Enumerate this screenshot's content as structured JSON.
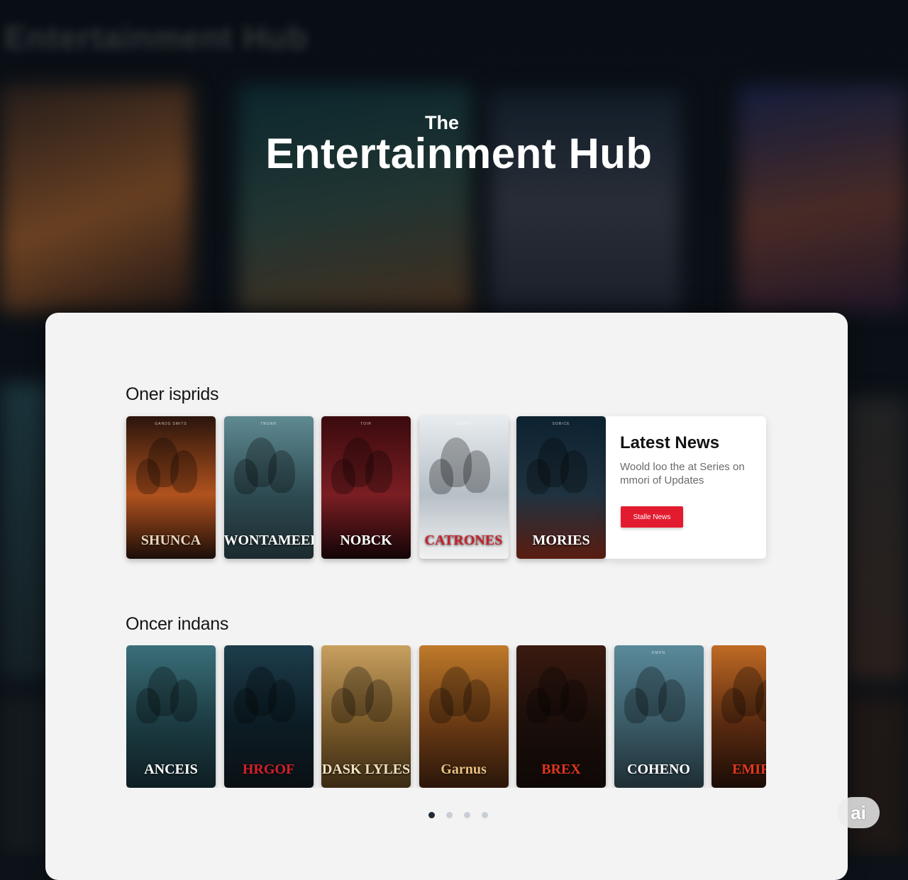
{
  "hero": {
    "kicker": "The",
    "title": "Entertainment Hub"
  },
  "sections": [
    {
      "title": "Oner isprids",
      "posters": [
        {
          "title": "SHUNCA",
          "credit": "GANDS SMITS",
          "colors": [
            "#2a140c",
            "#b0521e",
            "#1b0d08"
          ],
          "title_color": "#e9d6bf"
        },
        {
          "title": "WONTAMEER",
          "credit": "TRUNN",
          "colors": [
            "#5f8a92",
            "#2e4b52",
            "#1b2a2e"
          ],
          "title_color": "#ffffff"
        },
        {
          "title": "NOBCK",
          "credit": "TOIR",
          "colors": [
            "#3a0a0e",
            "#7a1e22",
            "#120406"
          ],
          "title_color": "#ffffff"
        },
        {
          "title": "CATRONES",
          "credit": "MIERR",
          "colors": [
            "#e8ecef",
            "#b6bfc6",
            "#f2f2f2"
          ],
          "title_color": "#c8202a"
        },
        {
          "title": "MORIES",
          "credit": "SOBICE",
          "colors": [
            "#0d2230",
            "#1f3240",
            "#5a1c10"
          ],
          "title_color": "#ffffff"
        }
      ]
    },
    {
      "title": "Oncer indans",
      "posters": [
        {
          "title": "ANCEIS",
          "credit": "",
          "colors": [
            "#3a6f7a",
            "#1c3b42",
            "#0e1f24"
          ],
          "title_color": "#ffffff"
        },
        {
          "title": "HRGOF",
          "credit": "",
          "colors": [
            "#1d3d4c",
            "#0c1c24",
            "#0a1014"
          ],
          "title_color": "#d61f2a"
        },
        {
          "title": "DASK LYLES",
          "credit": "",
          "colors": [
            "#c8a060",
            "#7a5a2a",
            "#3a2a14"
          ],
          "title_color": "#f0e2c0"
        },
        {
          "title": "Garnus",
          "credit": "",
          "colors": [
            "#c07a2a",
            "#6a3a14",
            "#2a160a"
          ],
          "title_color": "#e8c080"
        },
        {
          "title": "BREX",
          "credit": "",
          "colors": [
            "#3a1a10",
            "#1a0e0a",
            "#0e0806"
          ],
          "title_color": "#e0361e"
        },
        {
          "title": "COHENO",
          "credit": "KMON",
          "colors": [
            "#5a8a9a",
            "#3a5a66",
            "#1e2e34"
          ],
          "title_color": "#ffffff"
        },
        {
          "title": "EMIRE",
          "credit": "",
          "colors": [
            "#c06a24",
            "#5a2a10",
            "#1a0c06"
          ],
          "title_color": "#e03a1e"
        }
      ]
    }
  ],
  "news": {
    "heading": "Latest News",
    "body": "Woold loo the at Series on mmori of Updates",
    "button_label": "Stalle News"
  },
  "pagination": {
    "count": 4,
    "active": 0
  },
  "badge": {
    "text": "ai"
  }
}
